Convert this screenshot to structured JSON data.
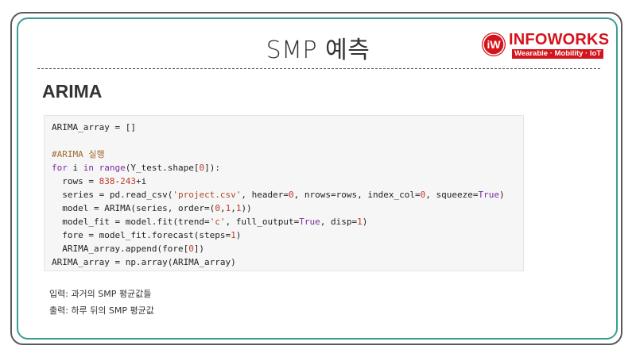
{
  "slide": {
    "title": "SMP 예측",
    "section_heading": "ARIMA"
  },
  "logo": {
    "mark": "iW",
    "name": "INFOWORKS",
    "tagline": "Wearable · Mobility · IoT",
    "color": "#d4141c"
  },
  "colors": {
    "outer_border": "#5a5a5a",
    "inner_border": "#3a9e93",
    "code_background": "#f6f6f6",
    "keyword": "#7a2b9e",
    "number": "#c0392b",
    "string": "#b04a24",
    "comment": "#a0692f"
  },
  "code": {
    "lines": [
      [
        {
          "t": "ARIMA_array = []",
          "c": "plain"
        }
      ],
      [],
      [
        {
          "t": "#ARIMA 실행",
          "c": "com"
        }
      ],
      [
        {
          "t": "for",
          "c": "kw"
        },
        {
          "t": " i ",
          "c": "plain"
        },
        {
          "t": "in",
          "c": "kw"
        },
        {
          "t": " ",
          "c": "plain"
        },
        {
          "t": "range",
          "c": "kw"
        },
        {
          "t": "(Y_test.shape[",
          "c": "plain"
        },
        {
          "t": "0",
          "c": "num"
        },
        {
          "t": "]):",
          "c": "plain"
        }
      ],
      [
        {
          "t": "  rows = ",
          "c": "plain"
        },
        {
          "t": "838",
          "c": "num"
        },
        {
          "t": "-",
          "c": "plain"
        },
        {
          "t": "243",
          "c": "num"
        },
        {
          "t": "+i",
          "c": "plain"
        }
      ],
      [
        {
          "t": "  series = pd.read_csv(",
          "c": "plain"
        },
        {
          "t": "'project.csv'",
          "c": "str"
        },
        {
          "t": ", header=",
          "c": "plain"
        },
        {
          "t": "0",
          "c": "num"
        },
        {
          "t": ", nrows=rows, index_col=",
          "c": "plain"
        },
        {
          "t": "0",
          "c": "num"
        },
        {
          "t": ", squeeze=",
          "c": "plain"
        },
        {
          "t": "True",
          "c": "kw"
        },
        {
          "t": ")",
          "c": "plain"
        }
      ],
      [
        {
          "t": "  model = ARIMA(series, order=(",
          "c": "plain"
        },
        {
          "t": "0",
          "c": "num"
        },
        {
          "t": ",",
          "c": "plain"
        },
        {
          "t": "1",
          "c": "num"
        },
        {
          "t": ",",
          "c": "plain"
        },
        {
          "t": "1",
          "c": "num"
        },
        {
          "t": "))",
          "c": "plain"
        }
      ],
      [
        {
          "t": "  model_fit = model.fit(trend=",
          "c": "plain"
        },
        {
          "t": "'c'",
          "c": "str"
        },
        {
          "t": ", full_output=",
          "c": "plain"
        },
        {
          "t": "True",
          "c": "kw"
        },
        {
          "t": ", disp=",
          "c": "plain"
        },
        {
          "t": "1",
          "c": "num"
        },
        {
          "t": ")",
          "c": "plain"
        }
      ],
      [
        {
          "t": "  fore = model_fit.forecast(steps=",
          "c": "plain"
        },
        {
          "t": "1",
          "c": "num"
        },
        {
          "t": ")",
          "c": "plain"
        }
      ],
      [
        {
          "t": "  ARIMA_array.append(fore[",
          "c": "plain"
        },
        {
          "t": "0",
          "c": "num"
        },
        {
          "t": "])",
          "c": "plain"
        }
      ],
      [
        {
          "t": "ARIMA_array = np.array(ARIMA_array)",
          "c": "plain"
        }
      ]
    ]
  },
  "notes": {
    "input": "입력: 과거의 SMP 평균값들",
    "output": "출력: 하루 뒤의 SMP 평균값"
  }
}
